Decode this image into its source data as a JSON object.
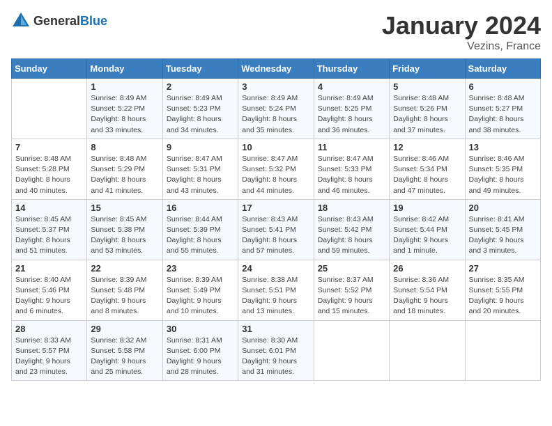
{
  "header": {
    "logo_general": "General",
    "logo_blue": "Blue",
    "month_title": "January 2024",
    "location": "Vezins, France"
  },
  "days_of_week": [
    "Sunday",
    "Monday",
    "Tuesday",
    "Wednesday",
    "Thursday",
    "Friday",
    "Saturday"
  ],
  "weeks": [
    [
      {
        "day": "",
        "info": ""
      },
      {
        "day": "1",
        "info": "Sunrise: 8:49 AM\nSunset: 5:22 PM\nDaylight: 8 hours\nand 33 minutes."
      },
      {
        "day": "2",
        "info": "Sunrise: 8:49 AM\nSunset: 5:23 PM\nDaylight: 8 hours\nand 34 minutes."
      },
      {
        "day": "3",
        "info": "Sunrise: 8:49 AM\nSunset: 5:24 PM\nDaylight: 8 hours\nand 35 minutes."
      },
      {
        "day": "4",
        "info": "Sunrise: 8:49 AM\nSunset: 5:25 PM\nDaylight: 8 hours\nand 36 minutes."
      },
      {
        "day": "5",
        "info": "Sunrise: 8:48 AM\nSunset: 5:26 PM\nDaylight: 8 hours\nand 37 minutes."
      },
      {
        "day": "6",
        "info": "Sunrise: 8:48 AM\nSunset: 5:27 PM\nDaylight: 8 hours\nand 38 minutes."
      }
    ],
    [
      {
        "day": "7",
        "info": "Sunrise: 8:48 AM\nSunset: 5:28 PM\nDaylight: 8 hours\nand 40 minutes."
      },
      {
        "day": "8",
        "info": "Sunrise: 8:48 AM\nSunset: 5:29 PM\nDaylight: 8 hours\nand 41 minutes."
      },
      {
        "day": "9",
        "info": "Sunrise: 8:47 AM\nSunset: 5:31 PM\nDaylight: 8 hours\nand 43 minutes."
      },
      {
        "day": "10",
        "info": "Sunrise: 8:47 AM\nSunset: 5:32 PM\nDaylight: 8 hours\nand 44 minutes."
      },
      {
        "day": "11",
        "info": "Sunrise: 8:47 AM\nSunset: 5:33 PM\nDaylight: 8 hours\nand 46 minutes."
      },
      {
        "day": "12",
        "info": "Sunrise: 8:46 AM\nSunset: 5:34 PM\nDaylight: 8 hours\nand 47 minutes."
      },
      {
        "day": "13",
        "info": "Sunrise: 8:46 AM\nSunset: 5:35 PM\nDaylight: 8 hours\nand 49 minutes."
      }
    ],
    [
      {
        "day": "14",
        "info": "Sunrise: 8:45 AM\nSunset: 5:37 PM\nDaylight: 8 hours\nand 51 minutes."
      },
      {
        "day": "15",
        "info": "Sunrise: 8:45 AM\nSunset: 5:38 PM\nDaylight: 8 hours\nand 53 minutes."
      },
      {
        "day": "16",
        "info": "Sunrise: 8:44 AM\nSunset: 5:39 PM\nDaylight: 8 hours\nand 55 minutes."
      },
      {
        "day": "17",
        "info": "Sunrise: 8:43 AM\nSunset: 5:41 PM\nDaylight: 8 hours\nand 57 minutes."
      },
      {
        "day": "18",
        "info": "Sunrise: 8:43 AM\nSunset: 5:42 PM\nDaylight: 8 hours\nand 59 minutes."
      },
      {
        "day": "19",
        "info": "Sunrise: 8:42 AM\nSunset: 5:44 PM\nDaylight: 9 hours\nand 1 minute."
      },
      {
        "day": "20",
        "info": "Sunrise: 8:41 AM\nSunset: 5:45 PM\nDaylight: 9 hours\nand 3 minutes."
      }
    ],
    [
      {
        "day": "21",
        "info": "Sunrise: 8:40 AM\nSunset: 5:46 PM\nDaylight: 9 hours\nand 6 minutes."
      },
      {
        "day": "22",
        "info": "Sunrise: 8:39 AM\nSunset: 5:48 PM\nDaylight: 9 hours\nand 8 minutes."
      },
      {
        "day": "23",
        "info": "Sunrise: 8:39 AM\nSunset: 5:49 PM\nDaylight: 9 hours\nand 10 minutes."
      },
      {
        "day": "24",
        "info": "Sunrise: 8:38 AM\nSunset: 5:51 PM\nDaylight: 9 hours\nand 13 minutes."
      },
      {
        "day": "25",
        "info": "Sunrise: 8:37 AM\nSunset: 5:52 PM\nDaylight: 9 hours\nand 15 minutes."
      },
      {
        "day": "26",
        "info": "Sunrise: 8:36 AM\nSunset: 5:54 PM\nDaylight: 9 hours\nand 18 minutes."
      },
      {
        "day": "27",
        "info": "Sunrise: 8:35 AM\nSunset: 5:55 PM\nDaylight: 9 hours\nand 20 minutes."
      }
    ],
    [
      {
        "day": "28",
        "info": "Sunrise: 8:33 AM\nSunset: 5:57 PM\nDaylight: 9 hours\nand 23 minutes."
      },
      {
        "day": "29",
        "info": "Sunrise: 8:32 AM\nSunset: 5:58 PM\nDaylight: 9 hours\nand 25 minutes."
      },
      {
        "day": "30",
        "info": "Sunrise: 8:31 AM\nSunset: 6:00 PM\nDaylight: 9 hours\nand 28 minutes."
      },
      {
        "day": "31",
        "info": "Sunrise: 8:30 AM\nSunset: 6:01 PM\nDaylight: 9 hours\nand 31 minutes."
      },
      {
        "day": "",
        "info": ""
      },
      {
        "day": "",
        "info": ""
      },
      {
        "day": "",
        "info": ""
      }
    ]
  ]
}
